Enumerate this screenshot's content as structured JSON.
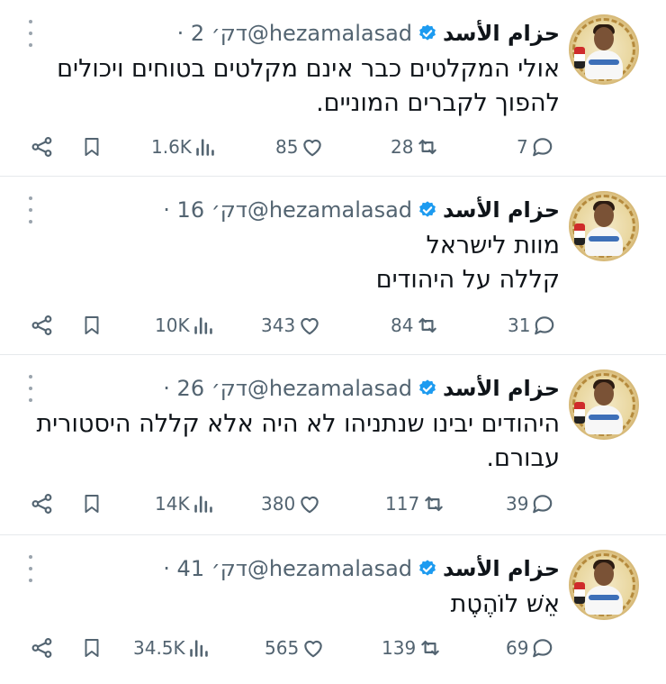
{
  "tweets": [
    {
      "name": "حزام الأسد",
      "handle": "@hezamalasad",
      "time": "· 2 דק׳",
      "lines": [
        "אולי המקלטים כבר אינם מקלטים בטוחים ויכולים",
        "להפוך לקברים המוניים."
      ],
      "replies": "7",
      "retweets": "28",
      "likes": "85",
      "views": "1.6K"
    },
    {
      "name": "حزام الأسد",
      "handle": "@hezamalasad",
      "time": "· 16 דק׳",
      "lines": [
        "מוות לישראל",
        "קללה על היהודים"
      ],
      "replies": "31",
      "retweets": "84",
      "likes": "343",
      "views": "10K"
    },
    {
      "name": "حزام الأسد",
      "handle": "@hezamalasad",
      "time": "· 26 דק׳",
      "lines": [
        "היהודים יבינו שנתניהו לא היה אלא קללה היסטורית",
        "עבורם."
      ],
      "replies": "39",
      "retweets": "117",
      "likes": "380",
      "views": "14K"
    },
    {
      "name": "حزام الأسد",
      "handle": "@hezamalasad",
      "time": "· 41 דק׳",
      "lines": [
        "אֵשׁ לוֹהֶטֶת"
      ],
      "replies": "69",
      "retweets": "139",
      "likes": "565",
      "views": "34.5K"
    }
  ],
  "icons": {
    "avatar": "profile-avatar",
    "verified": "verified-badge-icon",
    "more": "more-options-icon",
    "reply": "reply-icon",
    "retweet": "retweet-icon",
    "like": "like-icon",
    "views": "views-icon",
    "bookmark": "bookmark-icon",
    "share": "share-icon"
  },
  "colors": {
    "verified": "#1d9bf0",
    "text": "#0f1419",
    "muted": "#536471",
    "divider": "#e6e9ec"
  }
}
